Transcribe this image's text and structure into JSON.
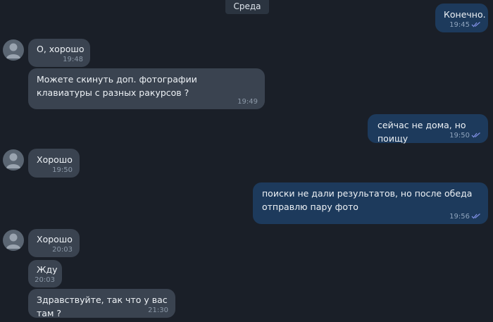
{
  "date_label": "Среда",
  "messages": [
    {
      "text": "Конечно.",
      "time": "19:45"
    },
    {
      "text": "О, хорошо",
      "time": "19:48"
    },
    {
      "text": "Можете скинуть доп. фотографии клавиатуры с разных ракурсов ?",
      "time": "19:49"
    },
    {
      "text": "сейчас не дома, но поищу",
      "time": "19:50"
    },
    {
      "text": "Хорошо",
      "time": "19:50"
    },
    {
      "text": "поиски не дали результатов, но после обеда отправлю пару фото",
      "time": "19:56"
    },
    {
      "text": "Хорошо",
      "time": "20:03"
    },
    {
      "text": "Жду",
      "time": "20:03"
    },
    {
      "text": "Здравствуйте, так что у вас там ?",
      "time": "21:30"
    }
  ],
  "colors": {
    "background": "#1a1f28",
    "incoming_bubble": "#3a4350",
    "outgoing_bubble": "#1d3a5c",
    "read_checks": "#7b8cde"
  },
  "icons": {
    "avatar": "user-silhouette-icon",
    "read_status": "double-check-icon"
  }
}
